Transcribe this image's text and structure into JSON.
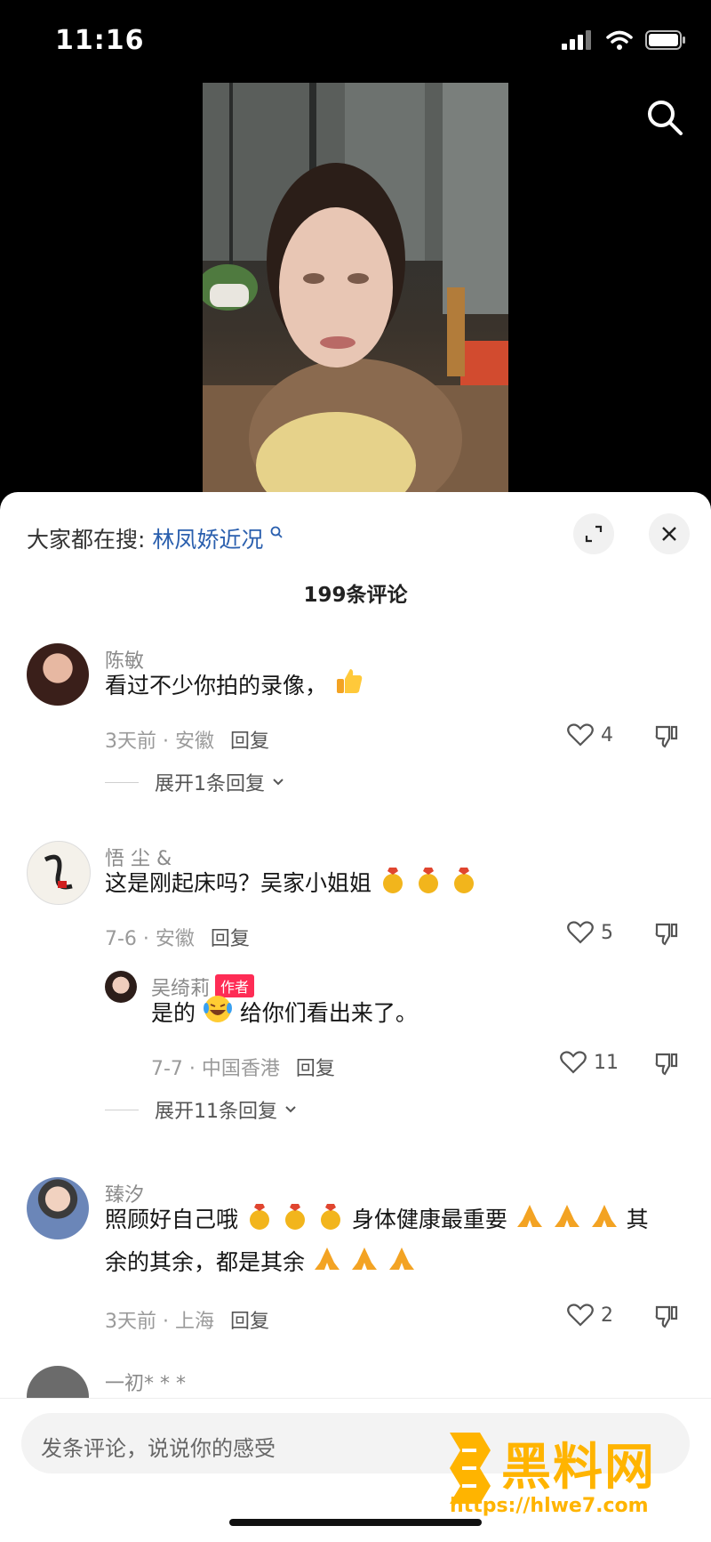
{
  "status_bar": {
    "time": "11:16"
  },
  "hot_search": {
    "label": "大家都在搜:",
    "keyword": "林凤娇近况"
  },
  "comment_count": "199条评论",
  "comments": [
    {
      "user": "陈敏",
      "text": "看过不少你拍的录像，",
      "meta": "3天前 · 安徽",
      "reply": "回复",
      "likes": "4",
      "expand": "展开1条回复"
    },
    {
      "user": "悟 尘 &",
      "text": "这是刚起床吗？吴家小姐姐",
      "meta": "7-6 · 安徽",
      "reply": "回复",
      "likes": "5",
      "sub": {
        "user": "吴绮莉",
        "tag": "作者",
        "text_a": "是的",
        "text_b": "给你们看出来了。",
        "meta": "7-7 · 中国香港",
        "reply": "回复",
        "likes": "11"
      },
      "expand": "展开11条回复"
    },
    {
      "user": "臻汐",
      "text_line1": "照顾好自己哦",
      "text_mid": "身体健康最重要",
      "text_end": "其",
      "text_line2": "余的其余，都是其余",
      "meta": "3天前 · 上海",
      "reply": "回复",
      "likes": "2"
    },
    {
      "user": "一初* * *"
    }
  ],
  "input_placeholder": "发条评论，说说你的感受",
  "watermark": {
    "title": "黑料网",
    "url": "https://hlwe7.com"
  }
}
